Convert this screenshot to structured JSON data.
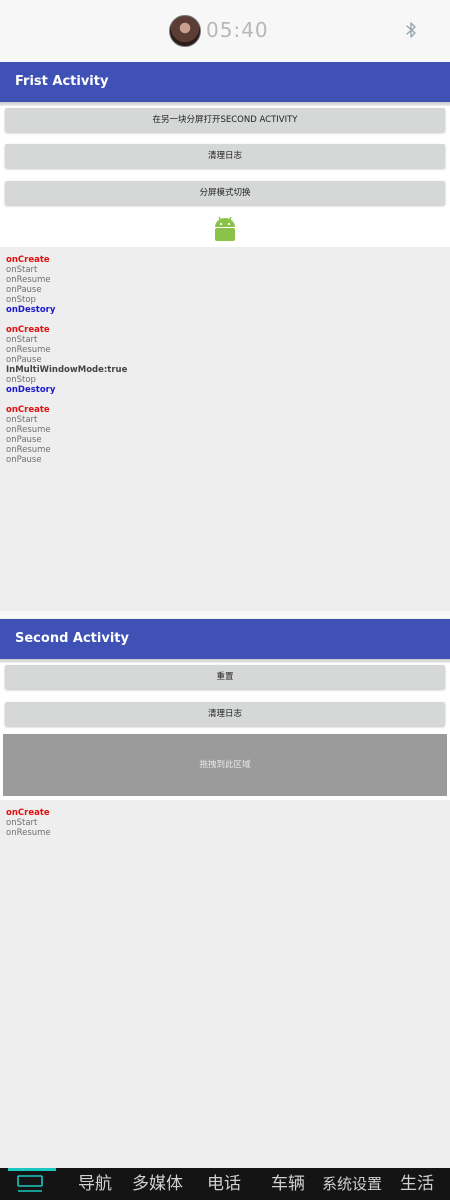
{
  "status_bar": {
    "time": "05:40",
    "bluetooth_icon": "bluetooth-icon"
  },
  "first_activity": {
    "title": "Frist Activity",
    "buttons": {
      "open_second": "在另一块分屏打开SECOND ACTIVITY",
      "clear_log": "清理日志",
      "toggle_split": "分屏模式切换"
    },
    "log": [
      {
        "text": "onCreate",
        "style": "red"
      },
      {
        "text": "onStart",
        "style": "normal"
      },
      {
        "text": "onResume",
        "style": "normal"
      },
      {
        "text": "onPause",
        "style": "normal"
      },
      {
        "text": "onStop",
        "style": "normal"
      },
      {
        "text": "onDestory",
        "style": "blue"
      },
      {
        "text": "",
        "style": "gap"
      },
      {
        "text": "onCreate",
        "style": "red"
      },
      {
        "text": "onStart",
        "style": "normal"
      },
      {
        "text": "onResume",
        "style": "normal"
      },
      {
        "text": "onPause",
        "style": "normal"
      },
      {
        "text": "InMultiWindowMode:true",
        "style": "dark"
      },
      {
        "text": "onStop",
        "style": "normal"
      },
      {
        "text": "onDestory",
        "style": "blue"
      },
      {
        "text": "",
        "style": "gap"
      },
      {
        "text": "onCreate",
        "style": "red"
      },
      {
        "text": "onStart",
        "style": "normal"
      },
      {
        "text": "onResume",
        "style": "normal"
      },
      {
        "text": "onPause",
        "style": "normal"
      },
      {
        "text": "onResume",
        "style": "normal"
      },
      {
        "text": "onPause",
        "style": "normal"
      }
    ]
  },
  "second_activity": {
    "title": "Second Activity",
    "buttons": {
      "reset": "重置",
      "clear_log": "清理日志"
    },
    "drop_area": "拖拽到此区域",
    "log": [
      {
        "text": "onCreate",
        "style": "red"
      },
      {
        "text": "onStart",
        "style": "normal"
      },
      {
        "text": "onResume",
        "style": "normal"
      }
    ]
  },
  "bottom_nav": {
    "items": [
      "导航",
      "多媒体",
      "电话",
      "车辆",
      "系统设置",
      "生活"
    ]
  },
  "colors": {
    "appbar": "#3f51b5",
    "log_red": "#e01010",
    "log_blue": "#1a1ad0",
    "nav_accent": "#19c6c0"
  }
}
